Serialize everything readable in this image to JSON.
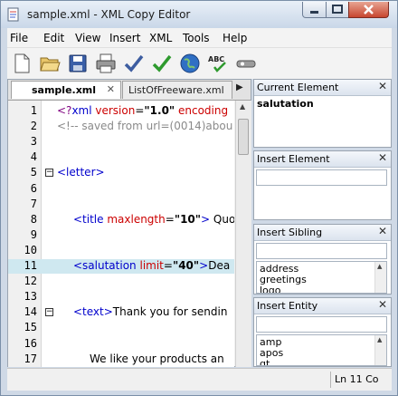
{
  "window": {
    "title": "sample.xml - XML Copy Editor"
  },
  "menu": [
    "File",
    "Edit",
    "View",
    "Insert",
    "XML",
    "Tools",
    "Help"
  ],
  "toolbar": {
    "icons": [
      "new-document-icon",
      "open-folder-icon",
      "save-icon",
      "print-icon",
      "check-wellformed-icon",
      "validate-icon",
      "browser-globe-icon",
      "spellcheck-icon",
      "toggle-icon"
    ]
  },
  "tabs": [
    {
      "label": "sample.xml",
      "active": true
    },
    {
      "label": "ListOfFreeware.xml",
      "active": false
    }
  ],
  "editor": {
    "lines": [
      {
        "n": "1",
        "parts": [
          [
            "pi",
            "<?"
          ],
          [
            "tag",
            "xml"
          ],
          [
            "txt",
            " "
          ],
          [
            "attr",
            "version"
          ],
          [
            "txt",
            "="
          ],
          [
            "val",
            "\"1.0\""
          ],
          [
            "txt",
            " "
          ],
          [
            "attr",
            "encoding"
          ]
        ]
      },
      {
        "n": "2",
        "parts": [
          [
            "comment",
            "<!-- saved from url=(0014)abou"
          ]
        ]
      },
      {
        "n": "3",
        "parts": []
      },
      {
        "n": "4",
        "parts": []
      },
      {
        "n": "5",
        "fold": "−",
        "parts": [
          [
            "tag",
            "<letter>"
          ]
        ]
      },
      {
        "n": "6",
        "parts": []
      },
      {
        "n": "7",
        "parts": []
      },
      {
        "n": "8",
        "indent": true,
        "parts": [
          [
            "tag",
            "<title"
          ],
          [
            "txt",
            " "
          ],
          [
            "attr",
            "maxlength"
          ],
          [
            "txt",
            "="
          ],
          [
            "val",
            "\"10\""
          ],
          [
            "tag",
            ">"
          ],
          [
            "txt",
            " Quo"
          ]
        ]
      },
      {
        "n": "9",
        "parts": []
      },
      {
        "n": "10",
        "parts": []
      },
      {
        "n": "11",
        "highlight": true,
        "indent": true,
        "parts": [
          [
            "tag",
            "<salutation"
          ],
          [
            "txt",
            " "
          ],
          [
            "attr",
            "limit"
          ],
          [
            "txt",
            "="
          ],
          [
            "val",
            "\"40\""
          ],
          [
            "tag",
            ">"
          ],
          [
            "txt",
            "Dea"
          ]
        ]
      },
      {
        "n": "12",
        "parts": []
      },
      {
        "n": "13",
        "parts": []
      },
      {
        "n": "14",
        "fold": "−",
        "indent": true,
        "parts": [
          [
            "tag",
            "<text>"
          ],
          [
            "txt",
            "Thank you for sendin"
          ]
        ]
      },
      {
        "n": "15",
        "parts": []
      },
      {
        "n": "16",
        "parts": []
      },
      {
        "n": "17",
        "indent2": true,
        "parts": [
          [
            "txt",
            "We like your products an"
          ]
        ]
      }
    ]
  },
  "panels": {
    "current_element": {
      "title": "Current Element",
      "value": "salutation"
    },
    "insert_element": {
      "title": "Insert Element"
    },
    "insert_sibling": {
      "title": "Insert Sibling",
      "items": [
        "address",
        "greetings",
        "logo"
      ]
    },
    "insert_entity": {
      "title": "Insert Entity",
      "items": [
        "amp",
        "apos",
        "gt"
      ]
    }
  },
  "status": {
    "position": "Ln 11 Co"
  },
  "colors": {
    "tag": "#0000cc",
    "attribute": "#cc0000",
    "comment": "#8a8a8a",
    "highlight": "#cfe8f0"
  }
}
